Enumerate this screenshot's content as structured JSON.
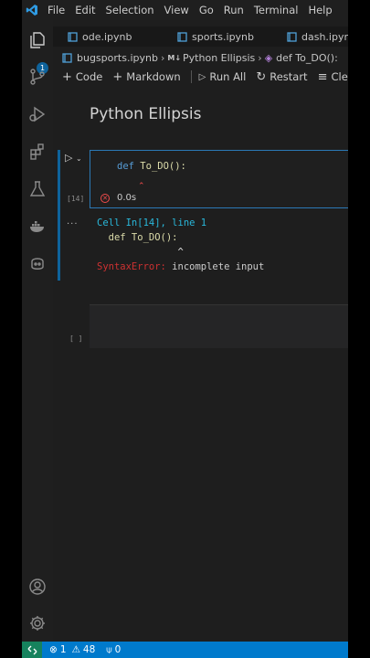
{
  "menu": [
    "File",
    "Edit",
    "Selection",
    "View",
    "Go",
    "Run",
    "Terminal",
    "Help"
  ],
  "activity": {
    "source_control_badge": "1"
  },
  "tabs": [
    {
      "label": "ode.ipynb"
    },
    {
      "label": "sports.ipynb"
    },
    {
      "label": "dash.ipynb"
    }
  ],
  "breadcrumb": {
    "file": "bugsports.ipynb",
    "md_prefix": "M↓",
    "section": "Python Ellipsis",
    "symbol": "def To_DO():"
  },
  "toolbar": {
    "code": "Code",
    "markdown": "Markdown",
    "run_all": "Run All",
    "restart": "Restart",
    "clear": "Clea"
  },
  "notebook": {
    "markdown_title": "Python Ellipsis",
    "cell": {
      "execution_count": "[14]",
      "code_keyword": "def",
      "code_rest": "To_DO():",
      "duration": "0.0s",
      "output_dots": "...",
      "output_line1": "Cell In[14], line 1",
      "output_line2": "  def To_DO():",
      "output_caret": "              ^",
      "error_name": "SyntaxError:",
      "error_msg": " incomplete input"
    },
    "empty_cell_count": "[ ]"
  },
  "statusbar": {
    "errors": "1",
    "warnings": "48",
    "ports": "0"
  },
  "colors": {
    "accent": "#007acc",
    "error": "#f14c4c",
    "remote": "#16825d"
  }
}
